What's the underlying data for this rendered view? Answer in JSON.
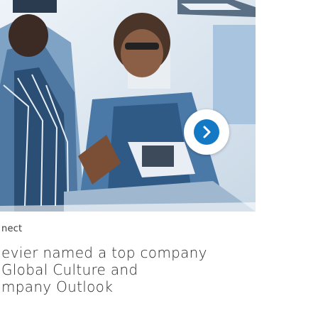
{
  "card": {
    "eyebrow": "nect",
    "headline_lines": [
      "evier named a top company",
      " Global Culture and",
      "mpany Outlook"
    ]
  },
  "video": {
    "play_icon": "play-icon",
    "accent_color": "#1479c4"
  }
}
